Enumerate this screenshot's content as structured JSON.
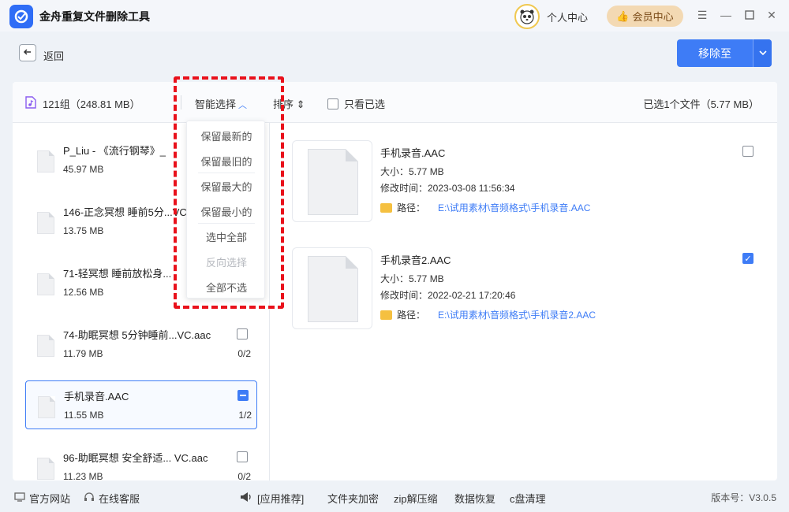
{
  "app": {
    "title": "金舟重复文件删除工具",
    "personal_center": "个人中心",
    "vip_center": "会员中心"
  },
  "toolbar": {
    "back": "返回",
    "move_to": "移除至"
  },
  "panel_header": {
    "group_count": "121组（248.81 MB）",
    "smart_select": "智能选择",
    "sort": "排序",
    "only_selected": "只看已选",
    "selected_summary": "已选1个文件（5.77 MB）"
  },
  "smart_menu": {
    "items": [
      {
        "label": "保留最新的",
        "disabled": false
      },
      {
        "label": "保留最旧的",
        "disabled": false
      },
      {
        "label": "保留最大的",
        "disabled": false
      },
      {
        "label": "保留最小的",
        "disabled": false
      },
      {
        "label": "选中全部",
        "disabled": false
      },
      {
        "label": "反向选择",
        "disabled": true
      },
      {
        "label": "全部不选",
        "disabled": false
      }
    ]
  },
  "groups": [
    {
      "name": "P_Liu - 《流行钢琴》_",
      "size": "45.97 MB",
      "count": "",
      "state": "none"
    },
    {
      "name": "146-正念冥想 睡前5分...VC",
      "size": "13.75 MB",
      "count": "",
      "state": "none"
    },
    {
      "name": "71-轻冥想 睡前放松身...",
      "size": "12.56 MB",
      "count": "",
      "state": "none"
    },
    {
      "name": "74-助眠冥想 5分钟睡前...VC.aac",
      "size": "11.79 MB",
      "count": "0/2",
      "state": "unchecked"
    },
    {
      "name": "手机录音.AAC",
      "size": "11.55 MB",
      "count": "1/2",
      "state": "indeterminate"
    },
    {
      "name": "96-助眠冥想 安全舒适...  VC.aac",
      "size": "11.23 MB",
      "count": "0/2",
      "state": "unchecked"
    }
  ],
  "files": [
    {
      "name": "手机录音.AAC",
      "size": "大小：5.77 MB",
      "mtime": "修改时间：2023-03-08 11:56:34",
      "path_label": "路径：",
      "path": "E:\\试用素材\\音频格式\\手机录音.AAC",
      "checked": false
    },
    {
      "name": "手机录音2.AAC",
      "size": "大小：5.77 MB",
      "mtime": "修改时间：2022-02-21 17:20:46",
      "path_label": "路径：",
      "path": "E:\\试用素材\\音频格式\\手机录音2.AAC",
      "checked": true
    }
  ],
  "footer": {
    "website": "官方网站",
    "support": "在线客服",
    "recommend": "[应用推荐]",
    "encrypt": "文件夹加密",
    "zip": "zip解压缩",
    "recover": "数据恢复",
    "clean": "c盘清理",
    "version": "版本号：V3.0.5"
  },
  "colors": {
    "accent": "#3e7cf6",
    "highlight": "#e9111b",
    "vip_bg": "#f3d9b3"
  }
}
